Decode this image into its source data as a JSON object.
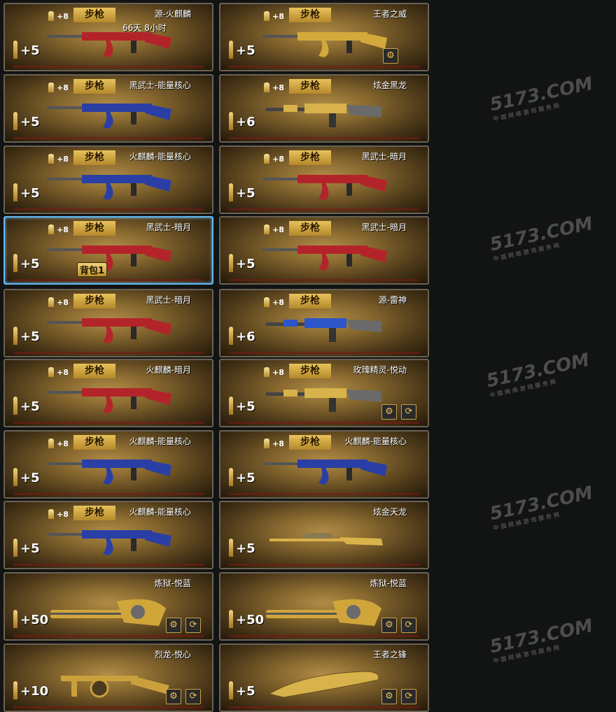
{
  "watermark": {
    "text": "5173.COM",
    "sub": "中国网络游戏服务网"
  },
  "cards": [
    {
      "tier": "+8",
      "type": "步枪",
      "name": "源-火麒麟",
      "time": "66天  8小时",
      "plus": "+5",
      "gun": "ak-red",
      "icons": []
    },
    {
      "tier": "+8",
      "type": "步枪",
      "name": "王者之威",
      "plus": "+5",
      "gun": "ak-gold",
      "icons": [
        "gear"
      ]
    },
    {
      "tier": "+8",
      "type": "步枪",
      "name": "黑武士-能量核心",
      "plus": "+5",
      "gun": "ak-blue",
      "icons": []
    },
    {
      "tier": "+8",
      "type": "步枪",
      "name": "炫金黑龙",
      "plus": "+6",
      "gun": "m4-gold",
      "icons": []
    },
    {
      "tier": "+8",
      "type": "步枪",
      "name": "火麒麟-能量核心",
      "plus": "+5",
      "gun": "ak-blue",
      "icons": []
    },
    {
      "tier": "+8",
      "type": "步枪",
      "name": "黑武士-暗月",
      "plus": "+5",
      "gun": "ak-red",
      "icons": []
    },
    {
      "tier": "+8",
      "type": "步枪",
      "name": "黑武士-暗月",
      "plus": "+5",
      "gun": "ak-red",
      "icons": [],
      "selected": true,
      "bag": "背包1"
    },
    {
      "tier": "+8",
      "type": "步枪",
      "name": "黑武士-暗月",
      "plus": "+5",
      "gun": "ak-red",
      "icons": []
    },
    {
      "tier": "+8",
      "type": "步枪",
      "name": "黑武士-暗月",
      "plus": "+5",
      "gun": "ak-red",
      "icons": []
    },
    {
      "tier": "+8",
      "type": "步枪",
      "name": "源-雷神",
      "plus": "+6",
      "gun": "m4-blue",
      "icons": []
    },
    {
      "tier": "+8",
      "type": "步枪",
      "name": "火麒麟-暗月",
      "plus": "+5",
      "gun": "ak-red",
      "icons": []
    },
    {
      "tier": "+8",
      "type": "步枪",
      "name": "玫瑰精灵-悦动",
      "plus": "+5",
      "gun": "m4-gold",
      "icons": [
        "gear",
        "swap"
      ]
    },
    {
      "tier": "+8",
      "type": "步枪",
      "name": "火麒麟-能量核心",
      "plus": "+5",
      "gun": "ak-blue",
      "icons": []
    },
    {
      "tier": "+8",
      "type": "步枪",
      "name": "火麒麟-能量核心",
      "plus": "+5",
      "gun": "ak-blue",
      "icons": []
    },
    {
      "tier": "+8",
      "type": "步枪",
      "name": "火麒麟-能量核心",
      "plus": "+5",
      "gun": "ak-blue",
      "icons": []
    },
    {
      "name": "炫金天龙",
      "plus": "+5",
      "gun": "sniper-gold",
      "icons": []
    },
    {
      "name": "炼狱-悦蓝",
      "plus": "+50",
      "gun": "gatling",
      "icons": [
        "gear",
        "swap"
      ]
    },
    {
      "name": "炼狱-悦蓝",
      "plus": "+50",
      "gun": "gatling",
      "icons": [
        "gear",
        "swap"
      ]
    },
    {
      "name": "烈龙-悦心",
      "plus": "+10",
      "gun": "thompson",
      "icons": [
        "gear",
        "swap"
      ]
    },
    {
      "name": "王者之锋",
      "plus": "+5",
      "gun": "blade",
      "icons": [
        "gear",
        "swap"
      ]
    }
  ],
  "colors": {
    "ak-red": "#b3242a",
    "ak-blue": "#2a3fa6",
    "ak-gold": "#d3a93c",
    "m4-gold": "#d8b24a",
    "m4-blue": "#2c55c9",
    "sniper-gold": "#d8b24a",
    "gatling": "#d0a53a",
    "thompson": "#caa03c",
    "blade": "#d8b24a"
  }
}
